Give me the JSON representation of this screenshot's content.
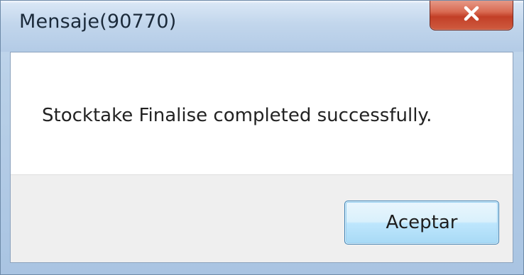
{
  "window": {
    "title": "Mensaje(90770)"
  },
  "dialog": {
    "message": "Stocktake Finalise completed successfully.",
    "ok_label": "Aceptar"
  },
  "icons": {
    "close": "close-icon"
  },
  "colors": {
    "close_button": "#c74a2f",
    "ok_button_border": "#3c7fb1",
    "title_bar": "#c2d6ec"
  }
}
